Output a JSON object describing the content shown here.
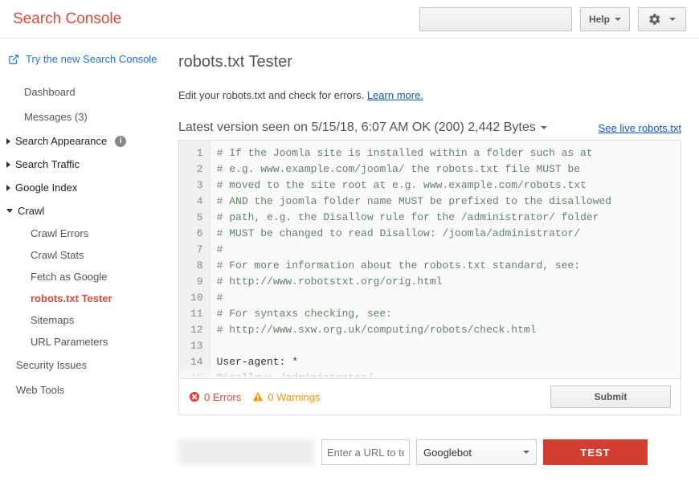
{
  "header": {
    "brand": "Search Console",
    "help": "Help"
  },
  "sidebar": {
    "try_new": "Try the new Search Console",
    "dashboard": "Dashboard",
    "messages": "Messages (3)",
    "appearance": "Search Appearance",
    "traffic": "Search Traffic",
    "google_index": "Google Index",
    "crawl": "Crawl",
    "crawl_errors": "Crawl Errors",
    "crawl_stats": "Crawl Stats",
    "fetch": "Fetch as Google",
    "robots": "robots.txt Tester",
    "sitemaps": "Sitemaps",
    "url_params": "URL Parameters",
    "security": "Security Issues",
    "web_tools": "Web Tools"
  },
  "main": {
    "title": "robots.txt Tester",
    "subtitle": "Edit your robots.txt and check for errors. ",
    "learn_more": "Learn more.",
    "version": "Latest version seen on 5/15/18, 6:07 AM OK (200) 2,442 Bytes",
    "live_link": "See live robots.txt",
    "errors": "0 Errors",
    "warnings": "0 Warnings",
    "submit": "Submit",
    "url_placeholder": "Enter a URL to test",
    "bot": "Googlebot",
    "test": "TEST"
  },
  "robots_lines": [
    "# If the Joomla site is installed within a folder such as at",
    "# e.g. www.example.com/joomla/ the robots.txt file MUST be",
    "# moved to the site root at e.g. www.example.com/robots.txt",
    "# AND the joomla folder name MUST be prefixed to the disallowed",
    "# path, e.g. the Disallow rule for the /administrator/ folder",
    "# MUST be changed to read Disallow: /joomla/administrator/",
    "#",
    "# For more information about the robots.txt standard, see:",
    "# http://www.robotstxt.org/orig.html",
    "#",
    "# For syntaxs checking, see:",
    "# http://www.sxw.org.uk/computing/robots/check.html",
    "",
    "User-agent: *",
    "Disallow: /administrator/"
  ]
}
